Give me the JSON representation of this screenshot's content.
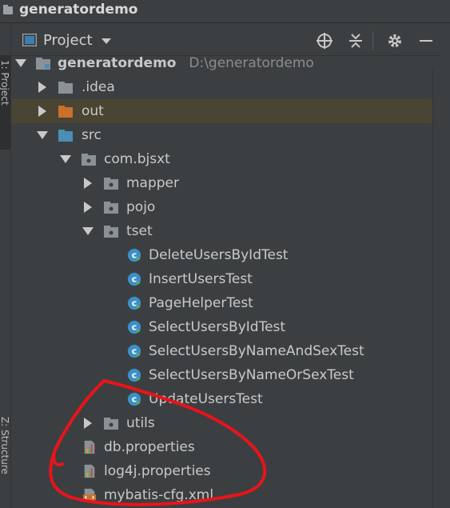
{
  "window": {
    "title": "generatordemo",
    "icon": "project-folder-icon"
  },
  "side_tabs": {
    "project_tab": "1: Project",
    "structure_tab": "Z: Structure"
  },
  "toolbar": {
    "view_label": "Project",
    "icons": [
      "locate-icon",
      "collapse-all-icon",
      "gear-icon",
      "minimize-icon"
    ]
  },
  "tree": {
    "root": {
      "name": "generatordemo",
      "path": "D:\\generatordemo"
    },
    "idea": ".idea",
    "out": "out",
    "src": "src",
    "pkg": "com.bjsxt",
    "mapper": "mapper",
    "pojo": "pojo",
    "tset": "tset",
    "classes": [
      "DeleteUsersByIdTest",
      "InsertUsersTest",
      "PageHelperTest",
      "SelectUsersByIdTest",
      "SelectUsersByNameAndSexTest",
      "SelectUsersByNameOrSexTest",
      "UpdateUsersTest"
    ],
    "utils": "utils",
    "files": [
      "db.properties",
      "log4j.properties",
      "mybatis-cfg.xml"
    ]
  },
  "colors": {
    "background": "#3c3f41",
    "selected_row": "#4a4432",
    "folder_gray": "#8a9297",
    "folder_orange": "#c9702b",
    "folder_blue": "#4a8fb3",
    "class_icon": "#3d8fc7",
    "annotation_red": "#e8141a"
  }
}
